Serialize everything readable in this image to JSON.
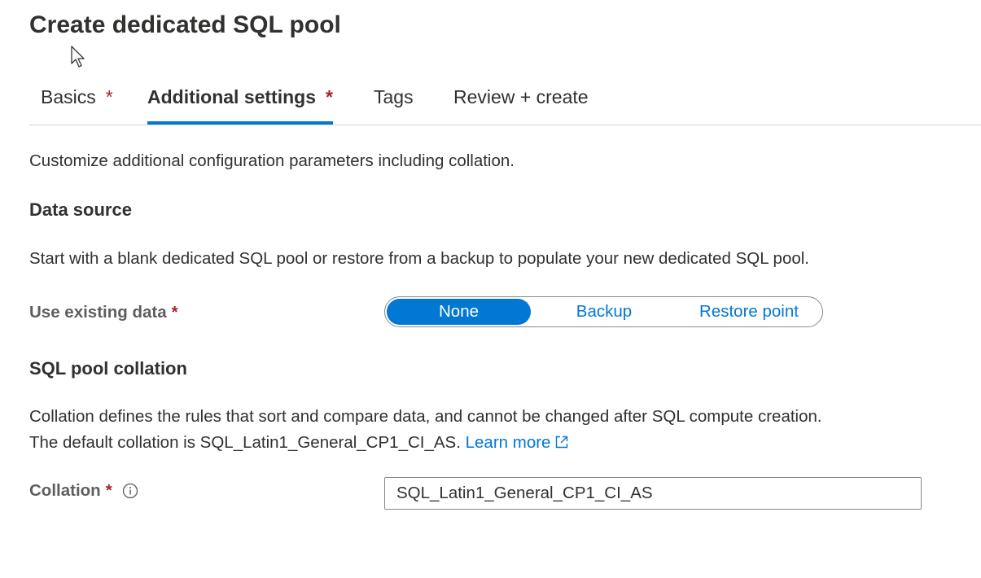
{
  "page": {
    "title": "Create dedicated SQL pool"
  },
  "tabs": [
    {
      "label": "Basics",
      "required_mark": "*"
    },
    {
      "label": "Additional settings",
      "required_mark": "*"
    },
    {
      "label": "Tags",
      "required_mark": ""
    },
    {
      "label": "Review + create",
      "required_mark": ""
    }
  ],
  "active_tab": "Additional settings",
  "intro": "Customize additional configuration parameters including collation.",
  "data_source": {
    "heading": "Data source",
    "description": "Start with a blank dedicated SQL pool or restore from a backup to populate your new dedicated SQL pool.",
    "field_label": "Use existing data",
    "required_mark": "*",
    "options": [
      "None",
      "Backup",
      "Restore point"
    ],
    "selected": "None"
  },
  "collation_section": {
    "heading": "SQL pool collation",
    "description_line1": "Collation defines the rules that sort and compare data, and cannot be changed after SQL compute creation.",
    "description_line2": "The default collation is SQL_Latin1_General_CP1_CI_AS.",
    "learn_more": "Learn more",
    "field_label": "Collation",
    "required_mark": "*",
    "value": "SQL_Latin1_General_CP1_CI_AS"
  },
  "icons": {
    "info": "info-icon",
    "external_link": "external-link-icon",
    "cursor": "mouse-cursor-icon"
  },
  "colors": {
    "accent": "#0078d4",
    "required": "#a4262c",
    "text": "#323130",
    "label": "#605e5c"
  }
}
